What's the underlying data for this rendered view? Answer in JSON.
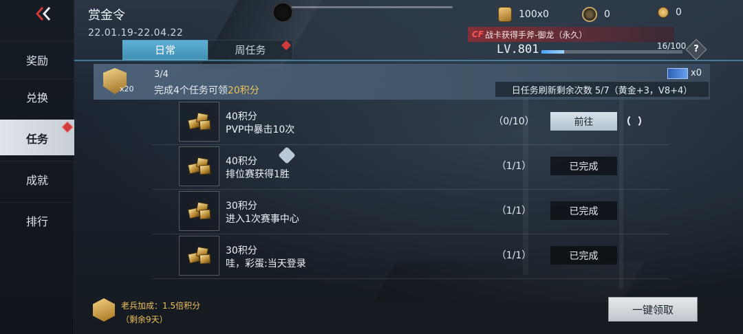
{
  "header": {
    "title": "赏金令",
    "dates": "22.01.19-22.04.22",
    "currencies": [
      {
        "icon": "gold-badge-icon",
        "value": "100x0"
      },
      {
        "icon": "medal-icon",
        "value": "0"
      },
      {
        "icon": "coin-icon",
        "value": "0"
      }
    ],
    "reward_banner": "战卡获得手斧-御龙（永久）",
    "reward_logo": "CF",
    "level": "LV.801",
    "level_progress_text": "16/100",
    "level_progress": 0.16
  },
  "sidebar": {
    "items": [
      {
        "label": "奖励"
      },
      {
        "label": "兑换"
      },
      {
        "label": "任务"
      },
      {
        "label": "成就"
      },
      {
        "label": "排行"
      }
    ]
  },
  "tabs": [
    {
      "label": "日常"
    },
    {
      "label": "周任务"
    }
  ],
  "summary": {
    "badge_count": "x20",
    "progress": "3/4",
    "desc_prefix": "完成4个任务可领",
    "desc_highlight": "20积分",
    "ticket_count": "x0",
    "refresh_text": "日任务刷新剩余次数 5/7（黄金+3，V8+4）"
  },
  "tasks": [
    {
      "points": "40积分",
      "name": "PVP中暴击10次",
      "progress": "（0/10）",
      "button": "前往"
    },
    {
      "points": "40积分",
      "name": "排位赛获得1胜",
      "progress": "（1/1）",
      "button": "已完成"
    },
    {
      "points": "30积分",
      "name": "进入1次赛事中心",
      "progress": "（1/1）",
      "button": "已完成"
    },
    {
      "points": "30积分",
      "name": "哇，彩蛋:当天登录",
      "progress": "（1/1）",
      "button": "已完成"
    }
  ],
  "footer": {
    "veteran_bonus": "老兵加成：1.5倍积分",
    "veteran_remaining": "（剩余9天）",
    "claim_all": "一键领取"
  }
}
